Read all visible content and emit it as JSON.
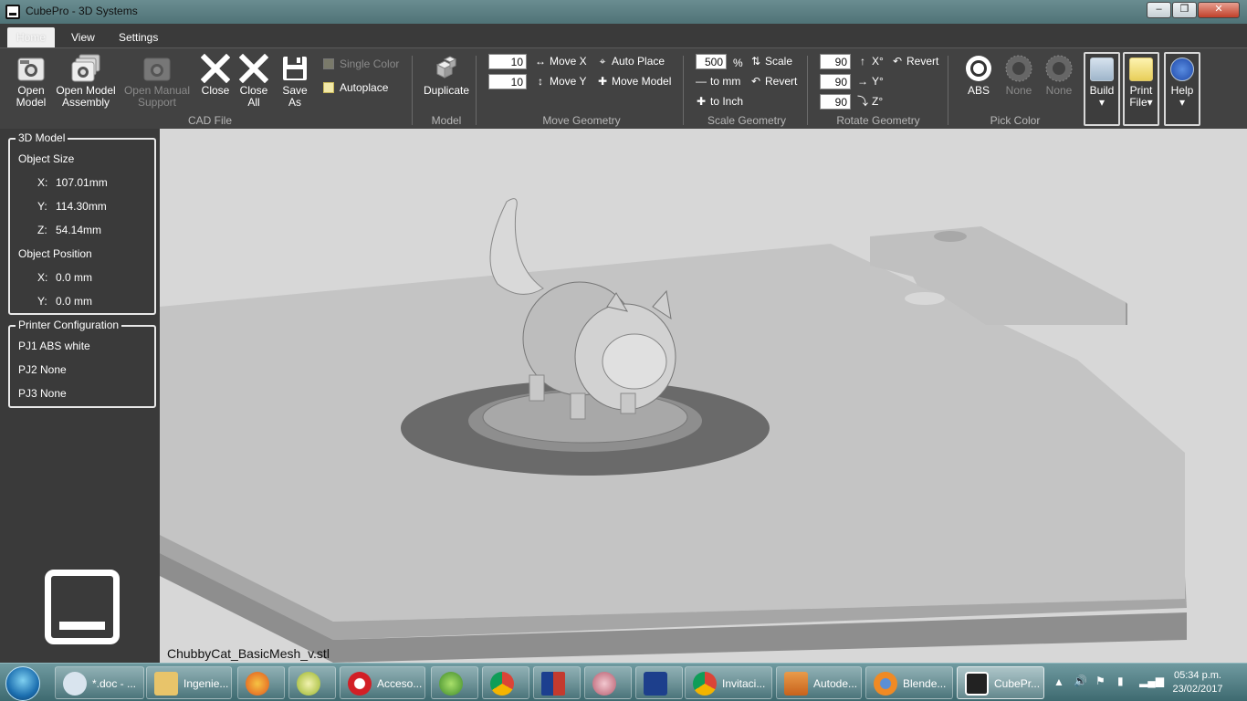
{
  "window": {
    "title": "CubePro - 3D Systems",
    "minimize": "–",
    "maximize": "❒",
    "close": "✕"
  },
  "menu": {
    "tabs": [
      "Home",
      "View",
      "Settings"
    ]
  },
  "ribbon": {
    "cad_file": {
      "label": "CAD File",
      "open_model": "Open\nModel",
      "open_model_assembly": "Open Model\nAssembly",
      "open_manual_support": "Open Manual\nSupport",
      "close": "Close",
      "close_all": "Close\nAll",
      "save_as": "Save\nAs",
      "single_color": "Single Color",
      "autoplace": "Autoplace"
    },
    "model": {
      "label": "Model",
      "duplicate": "Duplicate"
    },
    "move_geometry": {
      "label": "Move Geometry",
      "x_value": "10",
      "y_value": "10",
      "move_x": "Move X",
      "move_y": "Move Y",
      "auto_place": "Auto Place",
      "move_model": "Move Model"
    },
    "scale_geometry": {
      "label": "Scale Geometry",
      "value": "500",
      "unit": "%",
      "scale": "Scale",
      "to_mm": "to mm",
      "revert": "Revert",
      "to_inch": "to Inch"
    },
    "rotate_geometry": {
      "label": "Rotate Geometry",
      "x_value": "90",
      "y_value": "90",
      "z_value": "90",
      "x": "X°",
      "y": "Y°",
      "z": "Z°",
      "revert": "Revert"
    },
    "pick_color": {
      "label": "Pick Color",
      "colors": [
        "ABS",
        "None",
        "None"
      ]
    },
    "build": "Build",
    "print_file": "Print\nFile",
    "help": "Help"
  },
  "panel": {
    "model_title": "3D Model",
    "object_size": "Object Size",
    "size_x_label": "X:",
    "size_x": "107.01mm",
    "size_y_label": "Y:",
    "size_y": "114.30mm",
    "size_z_label": "Z:",
    "size_z": "54.14mm",
    "object_position": "Object Position",
    "pos_x_label": "X:",
    "pos_x": "0.0 mm",
    "pos_y_label": "Y:",
    "pos_y": "0.0 mm",
    "printer_title": "Printer Configuration",
    "pj1": "PJ1  ABS white",
    "pj2": "PJ2  None",
    "pj3": "PJ3  None"
  },
  "viewport": {
    "filename": "ChubbyCat_BasicMesh_v.stl"
  },
  "taskbar": {
    "items": [
      {
        "label": "*.doc - ...",
        "icon": "search-icon"
      },
      {
        "label": "Ingenie...",
        "icon": "folder-icon"
      },
      {
        "label": "",
        "icon": "firefox-icon"
      },
      {
        "label": "",
        "icon": "sync-icon"
      },
      {
        "label": "Acceso...",
        "icon": "opera-icon"
      },
      {
        "label": "",
        "icon": "globe-icon"
      },
      {
        "label": "",
        "icon": "chrome-icon"
      },
      {
        "label": "",
        "icon": "app-icon"
      },
      {
        "label": "",
        "icon": "pinwheel-icon"
      },
      {
        "label": "",
        "icon": "wb-icon"
      },
      {
        "label": "Invitaci...",
        "icon": "chrome-icon"
      },
      {
        "label": "Autode...",
        "icon": "autodesk-icon"
      },
      {
        "label": "Blende...",
        "icon": "blender-icon"
      },
      {
        "label": "CubePr...",
        "icon": "cubepro-icon"
      }
    ],
    "time": "05:34 p.m.",
    "date": "23/02/2017"
  }
}
